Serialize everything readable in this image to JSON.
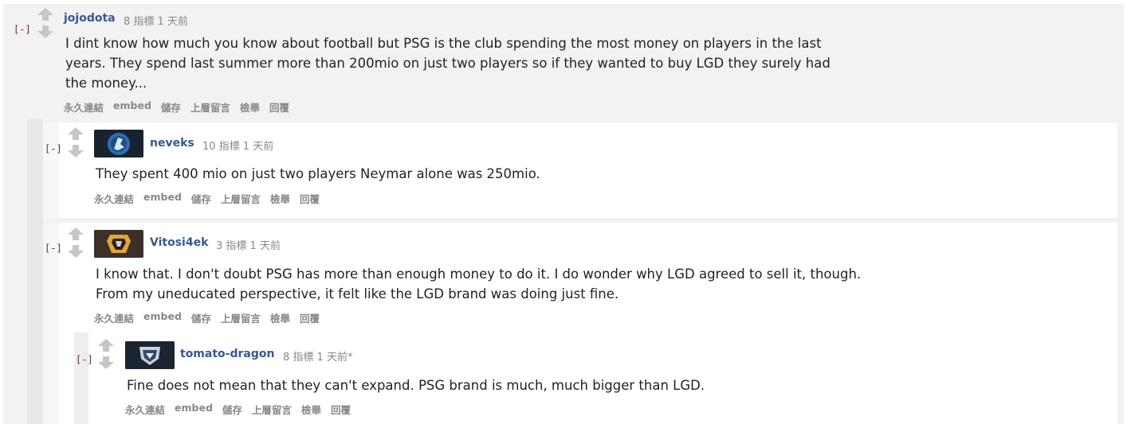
{
  "comments": [
    {
      "toggle": "[-]",
      "user": "jojodota",
      "meta": "8 指標 1 天前",
      "lines": [
        "I dint know how much you know about football but PSG is the club spending the most money on players in the last",
        "years. They spend last summer more than 200mio on just two players so if they wanted to buy LGD they surely had",
        "the money..."
      ],
      "actions": [
        "永久連結",
        "embed",
        "儲存",
        "上層留言",
        "檢舉",
        "回覆"
      ]
    },
    {
      "toggle": "[-]",
      "user": "neveks",
      "meta": "10 指標 1 天前",
      "avatar_icon": "team-liquid-horse-icon",
      "lines": [
        "They spent 400 mio on just two players Neymar alone was 250mio."
      ],
      "actions": [
        "永久連結",
        "embed",
        "儲存",
        "上層留言",
        "檢舉",
        "回覆"
      ]
    },
    {
      "toggle": "[-]",
      "user": "Vitosi4ek",
      "meta": "3 指標 1 天前",
      "avatar_icon": "virtus-pro-bear-icon",
      "lines": [
        "I know that. I don't doubt PSG has more than enough money to do it. I do wonder why LGD agreed to sell it, though.",
        "From my uneducated perspective, it felt like the LGD brand was doing just fine."
      ],
      "actions": [
        "永久連結",
        "embed",
        "儲存",
        "上層留言",
        "檢舉",
        "回覆"
      ]
    },
    {
      "toggle": "[-]",
      "user": "tomato-dragon",
      "meta": "8 指標 1 天前*",
      "avatar_icon": "shield-crest-icon",
      "lines": [
        "Fine does not mean that they can't expand. PSG brand is much, much bigger than LGD."
      ],
      "actions": [
        "永久連結",
        "embed",
        "儲存",
        "上層留言",
        "檢舉",
        "回覆"
      ]
    }
  ],
  "colors": {
    "level0_bg": "#f3f3f3",
    "level1_bg": "#f7f7f7",
    "inner_bg": "#ffffff",
    "username": "#37598b",
    "toggle": "#6a2b2b",
    "meta": "#888888"
  }
}
